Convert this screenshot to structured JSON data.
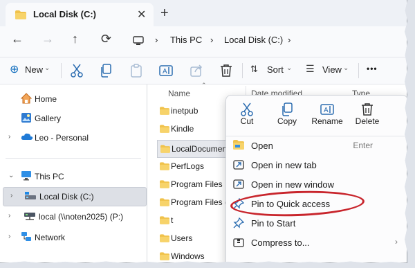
{
  "tab": {
    "title": "Local Disk (C:)",
    "close": "✕",
    "new_tab": "+"
  },
  "nav": {
    "back": "←",
    "forward": "→",
    "up": "↑",
    "refresh": "⟳"
  },
  "address": {
    "sep": "›",
    "items": [
      "This PC",
      "Local Disk (C:)"
    ]
  },
  "toolbar": {
    "new_label": "New",
    "sort_label": "Sort",
    "view_label": "View",
    "more": "•••"
  },
  "navpane": {
    "items": [
      {
        "label": "Home",
        "icon": "home-icon"
      },
      {
        "label": "Gallery",
        "icon": "gallery-icon"
      },
      {
        "label": "Leo - Personal",
        "icon": "cloud-icon"
      },
      {
        "label": "This PC",
        "icon": "pc-icon"
      },
      {
        "label": "Local Disk (C:)",
        "icon": "drive-icon"
      },
      {
        "label": "local (\\\\noten2025) (P:)",
        "icon": "network-drive-icon"
      },
      {
        "label": "Network",
        "icon": "network-icon"
      }
    ]
  },
  "filelist": {
    "col_name": "Name",
    "col_date": "Date modified",
    "col_type": "Type",
    "files": [
      "inetpub",
      "Kindle",
      "LocalDocuments",
      "PerfLogs",
      "Program Files",
      "Program Files (x",
      "t",
      "Users",
      "Windows"
    ]
  },
  "context_menu": {
    "top": [
      {
        "label": "Cut",
        "icon": "cut-icon"
      },
      {
        "label": "Copy",
        "icon": "copy-icon"
      },
      {
        "label": "Rename",
        "icon": "rename-icon"
      },
      {
        "label": "Delete",
        "icon": "delete-icon"
      }
    ],
    "items": [
      {
        "label": "Open",
        "shortcut": "Enter",
        "icon": "folder-icon"
      },
      {
        "label": "Open in new tab",
        "icon": "new-tab-icon"
      },
      {
        "label": "Open in new window",
        "icon": "new-window-icon"
      },
      {
        "label": "Pin to Quick access",
        "icon": "pin-icon"
      },
      {
        "label": "Pin to Start",
        "icon": "pin-start-icon"
      },
      {
        "label": "Compress to...",
        "icon": "compress-icon",
        "submenu": "›"
      }
    ]
  },
  "colors": {
    "folder": "#f0c24b",
    "accent": "#0f6cbd",
    "highlight_ring": "#c8252c"
  }
}
